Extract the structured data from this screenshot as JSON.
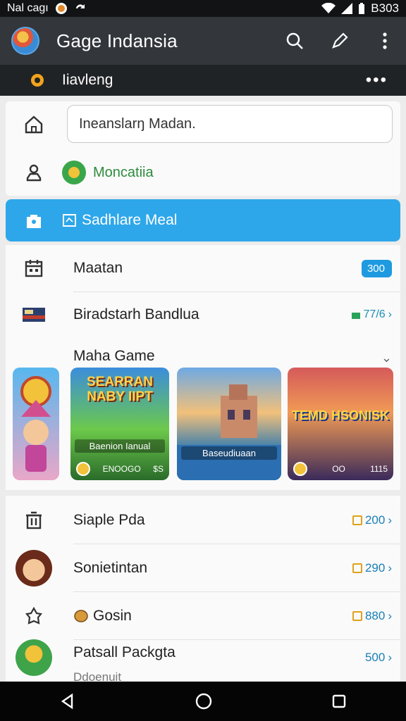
{
  "status_bar": {
    "left_text": "Nal cagı",
    "time": "B303"
  },
  "app_bar": {
    "title": "Gage Indansia"
  },
  "sub_bar": {
    "label": "Iiavleng",
    "more": "•••"
  },
  "search": {
    "value": "Ineanslarŋ Madan."
  },
  "location": {
    "label": "Moncatiia"
  },
  "selected_item": {
    "label": "Sadhlare Meal"
  },
  "list": [
    {
      "label": "Maatan",
      "badge": "300"
    },
    {
      "label": "Biradstarh Bandlua",
      "badge": "77/6"
    }
  ],
  "section": {
    "title": "Maha Game"
  },
  "games": [
    {
      "title": "",
      "subtitle": "",
      "meta_left": "",
      "meta_right": ""
    },
    {
      "title": "SEARRAN NABY IIPT",
      "subtitle": "Baenion Ianual",
      "meta_left": "ENOOGO",
      "meta_right": "$S"
    },
    {
      "title": "",
      "subtitle": "Baseudiuaan",
      "meta_left": "",
      "meta_right": ""
    },
    {
      "title": "TEMD HSONISK",
      "subtitle": "",
      "meta_left": "OO",
      "meta_right": "1115"
    }
  ],
  "list2": [
    {
      "label": "Siaple Pda",
      "value": "200"
    },
    {
      "label": "Sonietintan",
      "value": "290"
    },
    {
      "label": "Gosin",
      "value": "880"
    },
    {
      "label": "Patsall Packgta",
      "value": "500",
      "sublabel": "Ddoenuit"
    }
  ],
  "colors": {
    "accent": "#2ea7ea",
    "appbar": "#33373c",
    "green": "#3aa64a"
  }
}
